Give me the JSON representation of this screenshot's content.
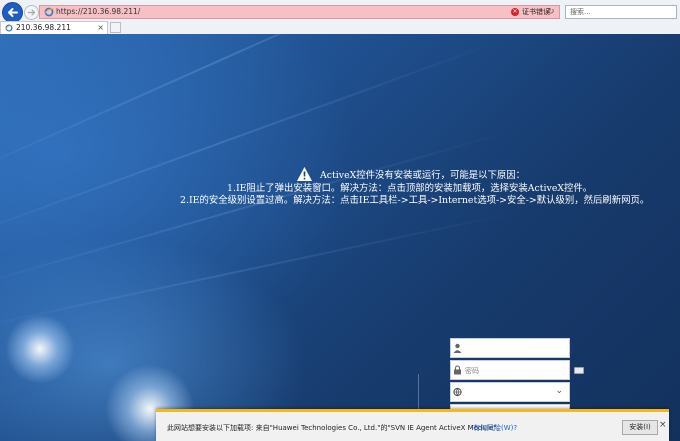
{
  "browser": {
    "address_url": "https://210.36.98.211/",
    "cert_error": "证书错误",
    "search_placeholder": "搜索...",
    "tab_title": "210.36.98.211",
    "tab_close": "×"
  },
  "notice": {
    "line0": "ActiveX控件没有安装或运行，可能是以下原因：",
    "line1": "1.IE阻止了弹出安装窗口。解决方法：点击顶部的安装加载项，选择安装ActiveX控件。",
    "line2": "2.IE的安全级别设置过高。解决方法：点击IE工具栏->工具->Internet选项->安全->默认级别，然后刷新网页。"
  },
  "login": {
    "username_placeholder": "",
    "password_placeholder": "密码",
    "domain_value": ""
  },
  "notification": {
    "message": "此网站想要安装以下加载项: 来自\"Huawei Technologies Co., Ltd.\"的\"SVN IE Agent ActiveX Module\"。",
    "risk_link": "有何风险(W)?",
    "install_label": "安装(I)",
    "close": "×"
  },
  "colors": {
    "accent": "#1f5cc4",
    "address_error_bg": "#f7c0c4",
    "notification_border": "#f5b81c",
    "link": "#1a5fc4"
  },
  "icons": [
    "back-arrow-icon",
    "forward-arrow-icon",
    "ie-favicon-icon",
    "cert-error-icon",
    "reload-icon",
    "warning-icon",
    "user-icon",
    "lock-icon",
    "globe-icon",
    "chevron-down-icon",
    "keyboard-icon",
    "close-icon"
  ]
}
